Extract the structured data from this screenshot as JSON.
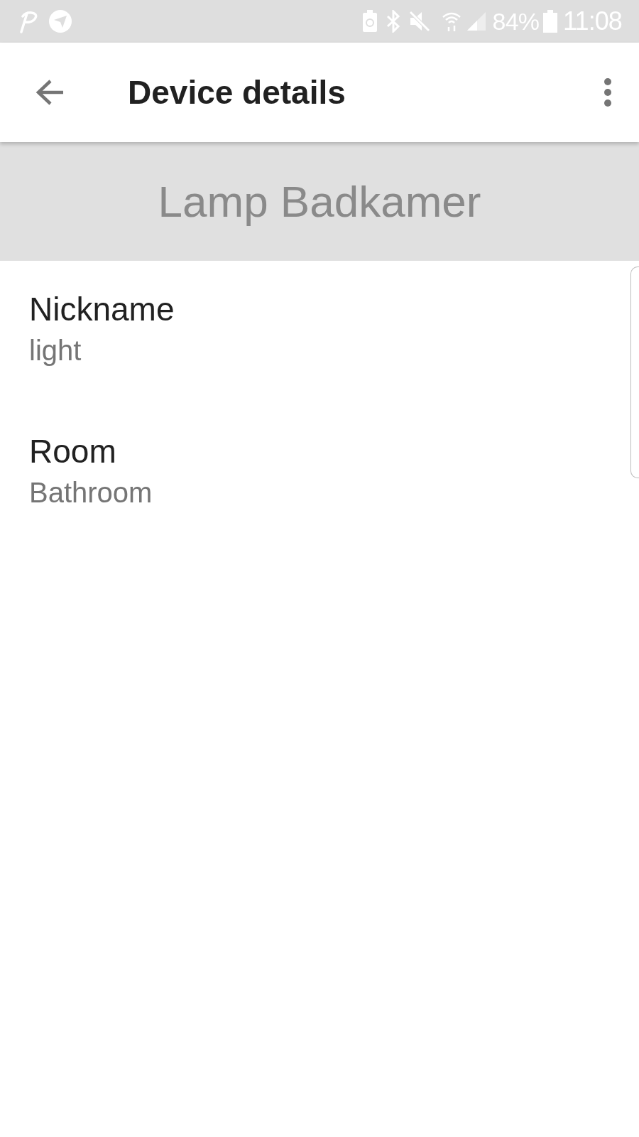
{
  "status_bar": {
    "battery": "84%",
    "time": "11:08"
  },
  "app_bar": {
    "title": "Device details"
  },
  "header": {
    "device_name": "Lamp Badkamer"
  },
  "fields": [
    {
      "label": "Nickname",
      "value": "light"
    },
    {
      "label": "Room",
      "value": "Bathroom"
    }
  ]
}
